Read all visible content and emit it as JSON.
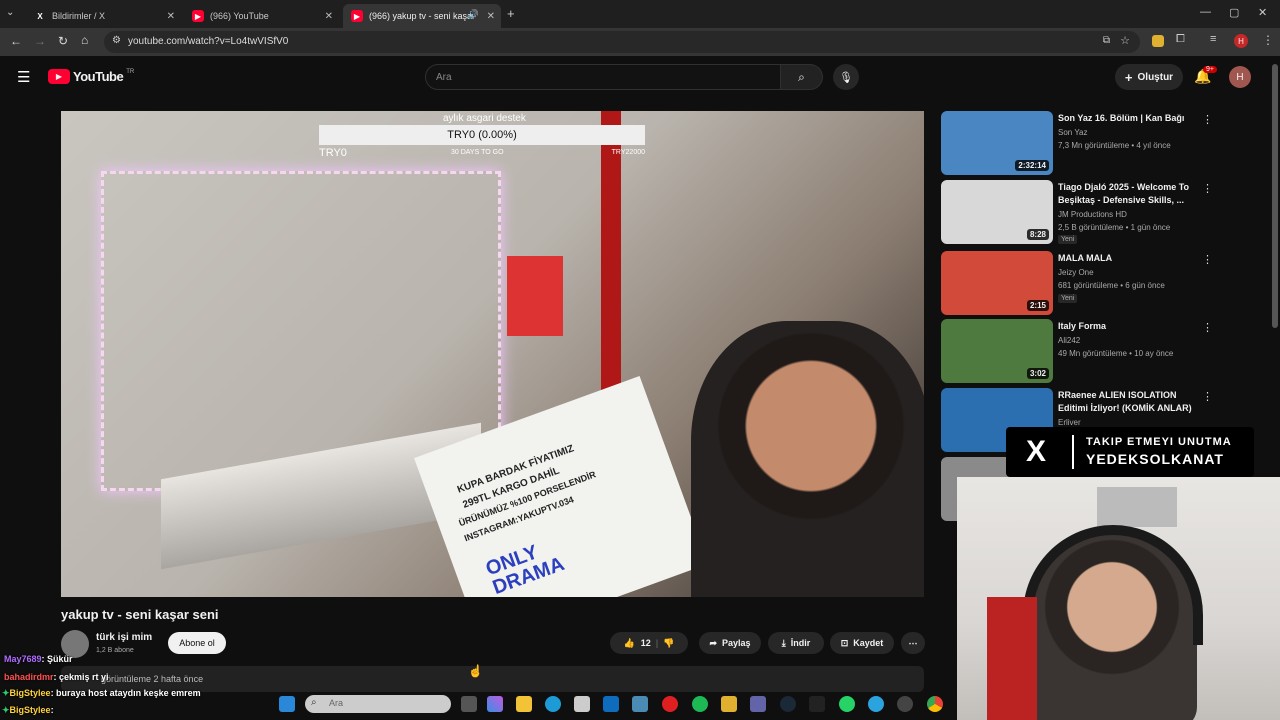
{
  "browser": {
    "tabs": [
      {
        "label": "Bildirimler / X",
        "icon": "x-logo-icon"
      },
      {
        "label": "(966) YouTube",
        "icon": "youtube-icon"
      },
      {
        "label": "(966) yakup tv - seni kaşar",
        "icon": "youtube-icon"
      }
    ],
    "url": "youtube.com/watch?v=Lo4twVISfV0"
  },
  "yt_header": {
    "logo": "YouTube",
    "region": "TR",
    "search_placeholder": "Ara",
    "create_label": "Oluştur",
    "notif_count": "9+",
    "avatar_letter": "H"
  },
  "video": {
    "donation": {
      "label": "aylık asgari destek",
      "amount": "TRY0 (0.00%)",
      "left": "TRY0",
      "middle": "30 DAYS TO GO",
      "right": "TRY22000"
    },
    "sign_lines": [
      "KUPA BARDAK FİYATIMIZ",
      "299TL KARGO DAHİL",
      "ÜRÜNÜMÜZ %100 PORSELENDİR",
      "INSTAGRAM:YAKUPTV.034"
    ],
    "sign_logo": "ONLY DRAMA",
    "title": "yakup tv - seni kaşar seni",
    "channel": "türk işi mim",
    "subscribers": "1,2 B abone",
    "subscribe_label": "Abone ol",
    "likes": "12",
    "share_label": "Paylaş",
    "download_label": "İndir",
    "save_label": "Kaydet",
    "views_info": "görüntüleme  2 hafta önce"
  },
  "chat": [
    {
      "user": "May7689",
      "msg": ": Şükür",
      "color": "#b06cff"
    },
    {
      "user": "bahadirdmr",
      "msg": ": çekmiş rt yi",
      "color": "#ff5050"
    },
    {
      "user": "BigStylee",
      "msg": ": buraya host atay​dın keşke emrem",
      "color": "#ffd23f"
    },
    {
      "user": "BigStylee",
      "msg": ":",
      "color": "#ffd23f"
    }
  ],
  "recommendations": [
    {
      "title": "Son Yaz 16. Bölüm | Kan Bağı",
      "channel": "Son Yaz",
      "meta": "7,3 Mn görüntüleme • 4 yıl önce",
      "duration": "2:32:14",
      "badge": "",
      "thumb_color": "#4a86c2"
    },
    {
      "title": "Tiago Djaló 2025 - Welcome To Beşiktaş - Defensive Skills, ...",
      "channel": "JM Productions HD",
      "meta": "2,5 B görüntüleme • 1 gün önce",
      "duration": "8:28",
      "badge": "Yeni",
      "thumb_color": "#d8d8d8"
    },
    {
      "title": "MALA MALA",
      "channel": "Jeizy One",
      "meta": "681 görüntüleme • 6 gün önce",
      "duration": "2:15",
      "badge": "Yeni",
      "thumb_color": "#d24a3a"
    },
    {
      "title": "Italy Forma",
      "channel": "Ali242",
      "meta": "49 Mn görüntüleme • 10 ay önce",
      "duration": "3:02",
      "badge": "",
      "thumb_color": "#4f7a3f"
    },
    {
      "title": "RRaenee ALIEN ISOLATION Editimi İzliyor! (KOMİK ANLAR)",
      "channel": "Erliver",
      "meta": "",
      "duration": "",
      "badge": "",
      "thumb_color": "#2c6fb0"
    }
  ],
  "overlay": {
    "promo_line1": "TAKIP ETMEYI UNUTMA",
    "promo_line2": "YEDEKSOLKANAT"
  },
  "taskbar": {
    "search_placeholder": "Ara"
  }
}
